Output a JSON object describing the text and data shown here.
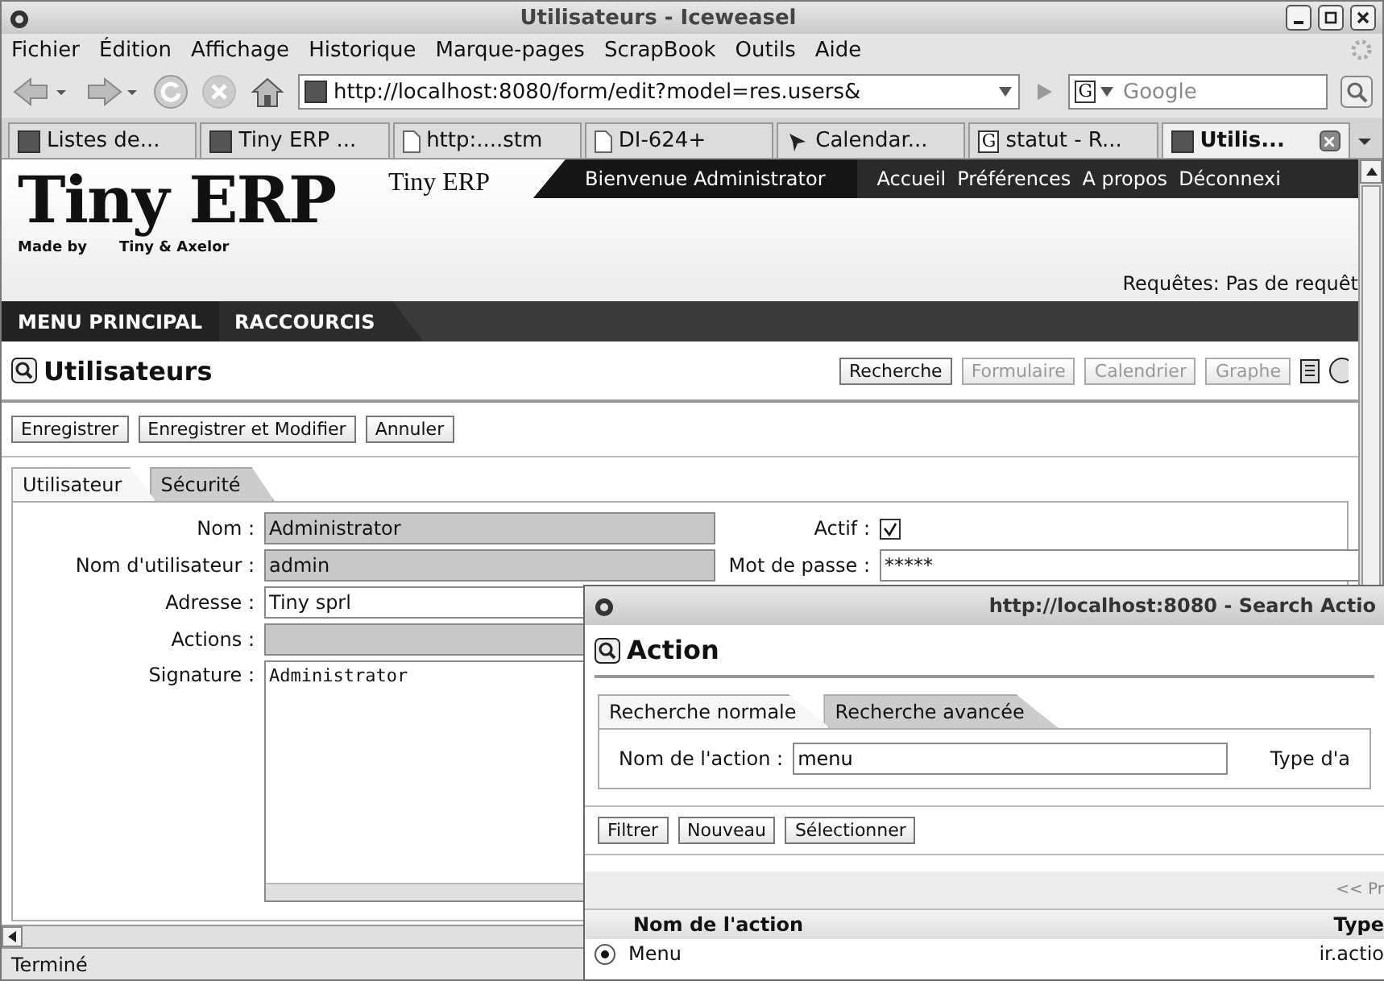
{
  "window": {
    "title": "Utilisateurs - Iceweasel"
  },
  "menu": [
    "Fichier",
    "Édition",
    "Affichage",
    "Historique",
    "Marque-pages",
    "ScrapBook",
    "Outils",
    "Aide"
  ],
  "toolbar": {
    "url": "http://localhost:8080/form/edit?model=res.users&",
    "search_engine": "G",
    "search_placeholder": "Google"
  },
  "browser_tabs": [
    {
      "label": "Listes de...",
      "kind": "square",
      "selected": false
    },
    {
      "label": "Tiny ERP ...",
      "kind": "square",
      "selected": false
    },
    {
      "label": "http:....stm",
      "kind": "document",
      "selected": false
    },
    {
      "label": "DI-624+",
      "kind": "document",
      "selected": false
    },
    {
      "label": "Calendar...",
      "kind": "bird",
      "selected": false
    },
    {
      "label": "statut - R...",
      "kind": "letter",
      "icon": "G",
      "selected": false
    },
    {
      "label": "Utilis...",
      "kind": "square",
      "selected": true
    }
  ],
  "header": {
    "logo": "Tiny ERP",
    "made_by": "Made by",
    "company": "Tiny & Axelor",
    "small_logo": "Tiny ERP",
    "welcome": "Bienvenue Administrator",
    "links": [
      "Accueil",
      "Préférences",
      "A propos",
      "Déconnexi"
    ],
    "requests": "Requêtes: Pas de requêt"
  },
  "nav": [
    "MENU PRINCIPAL",
    "RACCOURCIS"
  ],
  "view": {
    "title": "Utilisateurs",
    "buttons": [
      {
        "label": "Recherche",
        "disabled": false
      },
      {
        "label": "Formulaire",
        "disabled": true
      },
      {
        "label": "Calendrier",
        "disabled": true
      },
      {
        "label": "Graphe",
        "disabled": true
      }
    ]
  },
  "actions": [
    "Enregistrer",
    "Enregistrer et Modifier",
    "Annuler"
  ],
  "form_tabs": [
    {
      "label": "Utilisateur",
      "selected": true
    },
    {
      "label": "Sécurité",
      "selected": false
    }
  ],
  "fields": [
    {
      "label": "Nom :",
      "value": "Administrator",
      "kind": "input",
      "required": true
    },
    {
      "label": "Nom d'utilisateur :",
      "value": "admin",
      "kind": "input",
      "required": true
    },
    {
      "label": "Adresse :",
      "value": "Tiny sprl",
      "kind": "input",
      "required": false
    },
    {
      "label": "Actions :",
      "kind": "input",
      "required": true
    },
    {
      "label": "Signature :",
      "value": "Administrator",
      "kind": "textarea",
      "required": false
    }
  ],
  "active": {
    "label": "Actif :",
    "checked": true
  },
  "password": {
    "label": "Mot de passe :",
    "value": "*****"
  },
  "status_bar": "Terminé",
  "popup": {
    "title": "http://localhost:8080 - Search Actio",
    "heading": "Action",
    "tabs": [
      {
        "label": "Recherche normale",
        "selected": true
      },
      {
        "label": "Recherche avancée",
        "selected": false
      }
    ],
    "field_label": "Nom de l'action :",
    "field_value": "menu",
    "field2_label": "Type d'a",
    "buttons": [
      "Filtrer",
      "Nouveau",
      "Sélectionner"
    ],
    "pager": "<< Pr",
    "columns": [
      "Nom de l'action",
      "Type"
    ],
    "rows": [
      {
        "cells": [
          "Menu",
          "ir.actio"
        ],
        "selected": true
      }
    ]
  }
}
